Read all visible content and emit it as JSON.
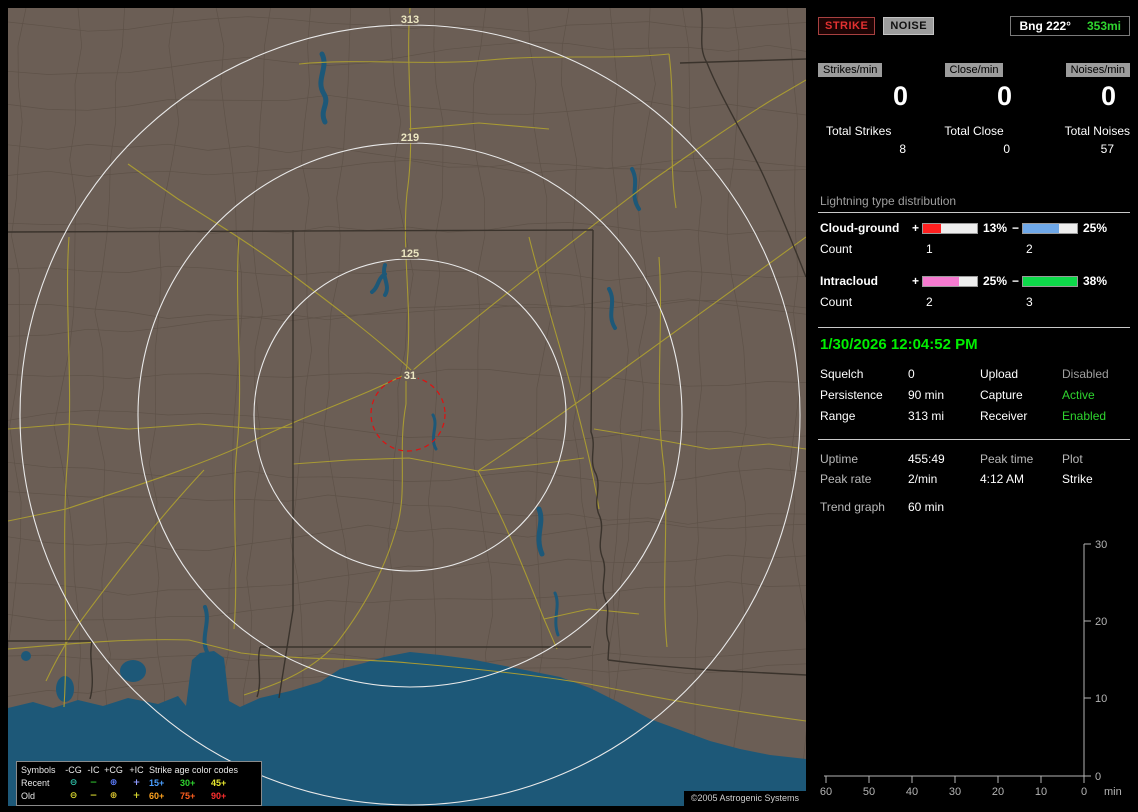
{
  "map": {
    "ring_labels": [
      "313",
      "219",
      "125",
      "31"
    ],
    "legend": {
      "symbols_header": "Symbols",
      "type_headers": [
        "-CG",
        "-IC",
        "+CG",
        "+IC"
      ],
      "age_header": "Strike age color codes",
      "rows": [
        {
          "label": "Recent",
          "symbols": [
            {
              "glyph": "⊖",
              "color": "#2fbfa8"
            },
            {
              "glyph": "−",
              "color": "#2fbf2f"
            },
            {
              "glyph": "⊕",
              "color": "#5c7dff"
            },
            {
              "glyph": "+",
              "color": "#8f9bff"
            }
          ],
          "ages": [
            {
              "text": "15+",
              "color": "#4b9fff"
            },
            {
              "text": "30+",
              "color": "#2fd42f"
            },
            {
              "text": "45+",
              "color": "#e8e82f"
            }
          ]
        },
        {
          "label": "Old",
          "symbols": [
            {
              "glyph": "⊖",
              "color": "#d9d92f"
            },
            {
              "glyph": "−",
              "color": "#d9d92f"
            },
            {
              "glyph": "⊕",
              "color": "#d9c42f"
            },
            {
              "glyph": "+",
              "color": "#d9d92f"
            }
          ],
          "ages": [
            {
              "text": "60+",
              "color": "#ffa31f"
            },
            {
              "text": "75+",
              "color": "#ff5f1f"
            },
            {
              "text": "90+",
              "color": "#ff2f2f"
            }
          ]
        }
      ]
    },
    "copyright": "©2005 Astrogenic Systems"
  },
  "panel": {
    "strike_button": "STRIKE",
    "noise_button": "NOISE",
    "bearing": {
      "label": "Bng 222°",
      "range": "353mi"
    },
    "rates": [
      {
        "header": "Strikes/min",
        "value": "0",
        "total_label": "Total Strikes",
        "total": "8"
      },
      {
        "header": "Close/min",
        "value": "0",
        "total_label": "Total Close",
        "total": "0"
      },
      {
        "header": "Noises/min",
        "value": "0",
        "total_label": "Total Noises",
        "total": "57"
      }
    ],
    "distribution": {
      "title": "Lightning type distribution",
      "count_label": "Count",
      "plus_sign": "+",
      "minus_sign": "−",
      "rows": [
        {
          "label": "Cloud-ground",
          "plus_pct": "13%",
          "plus_fill": 34,
          "plus_color": "#ff2020",
          "plus_count": "1",
          "minus_pct": "25%",
          "minus_fill": 66,
          "minus_color": "#6fa8e8",
          "minus_count": "2"
        },
        {
          "label": "Intracloud",
          "plus_pct": "25%",
          "plus_fill": 66,
          "plus_color": "#f57ad0",
          "plus_count": "2",
          "minus_pct": "38%",
          "minus_fill": 100,
          "minus_color": "#0ed94a",
          "minus_count": "3"
        }
      ]
    },
    "datetime": "1/30/2026 12:04:52 PM",
    "datetime_color": "#00ef00",
    "settings_rows": [
      {
        "label": "Squelch",
        "value": "0",
        "label2": "Upload",
        "value2": "Disabled",
        "value2_color": "#9f9f9f"
      },
      {
        "label": "Persistence",
        "value": "90 min",
        "label2": "Capture",
        "value2": "Active",
        "value2_color": "#2fd42f"
      },
      {
        "label": "Range",
        "value": "313 mi",
        "label2": "Receiver",
        "value2": "Enabled",
        "value2_color": "#2fd42f"
      }
    ],
    "status": {
      "uptime_label": "Uptime",
      "uptime": "455:49",
      "peak_time_label": "Peak time",
      "plot_label": "Plot",
      "peak_rate_label": "Peak rate",
      "peak_rate": "2/min",
      "peak_time": "4:12 AM",
      "plot_value": "Strike",
      "trend_label": "Trend graph",
      "trend_value": "60 min"
    },
    "trend": {
      "y_ticks": [
        "30",
        "20",
        "10",
        "0"
      ],
      "x_ticks": [
        "60",
        "50",
        "40",
        "30",
        "20",
        "10",
        "0"
      ],
      "unit": "min"
    }
  },
  "colors": {
    "land": "#6b5e55",
    "water": "#1d5878",
    "road": "#a89a33",
    "county_line": "#5a4e44",
    "state_line": "#3a332c",
    "range_ring": "#e9e9e9",
    "alarm_ring": "#e01010",
    "panel_accent_green": "#2fd42f",
    "strike_red": "#e23131"
  }
}
